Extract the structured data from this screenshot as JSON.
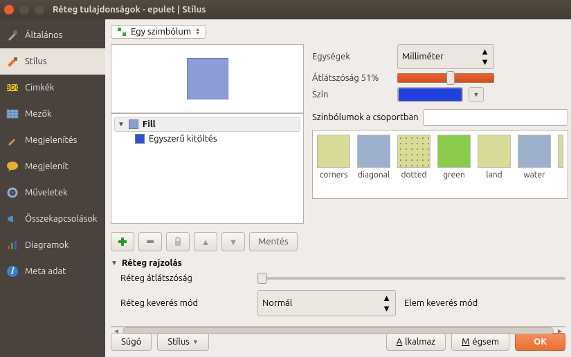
{
  "window": {
    "title": "Réteg tulajdonságok - epulet | Stílus"
  },
  "sidebar": {
    "items": [
      {
        "label": "Általános"
      },
      {
        "label": "Stílus"
      },
      {
        "label": "Cimkék"
      },
      {
        "label": "Mezők"
      },
      {
        "label": "Megjelenítés"
      },
      {
        "label": "Megjelenít"
      },
      {
        "label": "Műveletek"
      },
      {
        "label": "Összekapcsolások"
      },
      {
        "label": "Diagramok"
      },
      {
        "label": "Meta adat"
      }
    ]
  },
  "symbolMode": {
    "label": "Egy szimbólum"
  },
  "tree": {
    "fill": "Fill",
    "simple": "Egyszerű kitöltés"
  },
  "props": {
    "unitsLabel": "Egységek",
    "unitsValue": "Milliméter",
    "opacityLabel": "Átlátszóság",
    "opacityValue": "51%",
    "colorLabel": "Szín",
    "groupLabel": "Szinbólumok a csoportban"
  },
  "thumbs": [
    {
      "name": "corners"
    },
    {
      "name": "diagonal"
    },
    {
      "name": "dotted"
    },
    {
      "name": "green"
    },
    {
      "name": "land"
    },
    {
      "name": "water"
    }
  ],
  "toolbar": {
    "save": "Mentés"
  },
  "rendering": {
    "header": "Réteg rajzolás",
    "opacity": "Réteg átlátszóság",
    "blendLabel": "Réteg keverés mód",
    "blendValue": "Normál",
    "elemBlend": "Elem keverés mód"
  },
  "footer": {
    "help": "Súgó",
    "style": "Stílus",
    "apply": "Alkalmaz",
    "cancel": "Mégsem",
    "ok": "OK"
  }
}
